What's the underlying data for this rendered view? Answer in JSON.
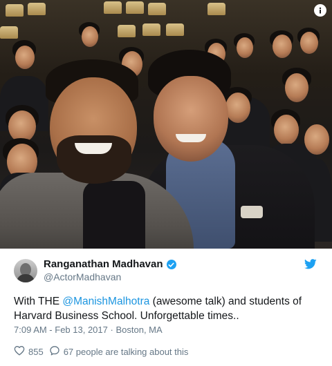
{
  "tweet": {
    "display_name": "Ranganathan Madhavan",
    "handle": "@ActorMadhavan",
    "text_before": "With THE ",
    "mention": "@ManishMalhotra",
    "text_after": " (awesome talk) and students of Harvard Business School. Unforgettable times..",
    "timestamp": "7:09 AM - Feb 13, 2017",
    "separator": "·",
    "location": "Boston, MA",
    "like_count": "855",
    "talking_text": "67 people are talking about this"
  },
  "icons": {
    "verified": "verified-badge-icon",
    "brand": "twitter-bird-icon",
    "info": "info-icon",
    "like": "heart-icon",
    "reply": "speech-bubble-icon"
  },
  "colors": {
    "brand_blue": "#1da1f2",
    "mention": "#1b95e0",
    "secondary_text": "#657786",
    "primary_text": "#14171a"
  }
}
